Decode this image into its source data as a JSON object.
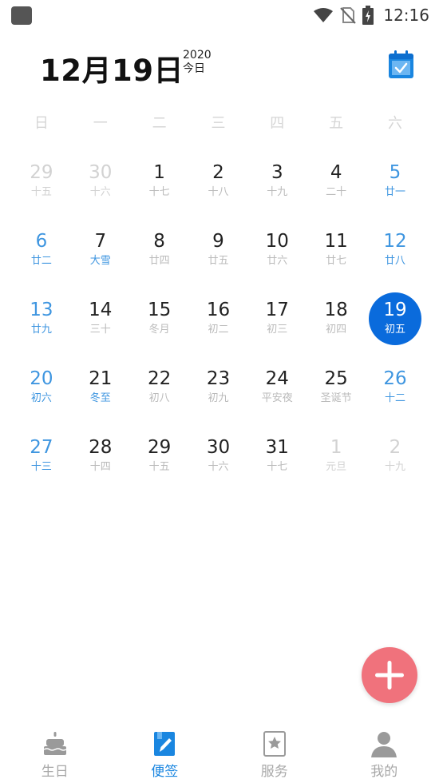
{
  "status_bar": {
    "time": "12:16"
  },
  "header": {
    "date": "12月19日",
    "year": "2020",
    "today": "今日"
  },
  "weekdays": [
    "日",
    "一",
    "二",
    "三",
    "四",
    "五",
    "六"
  ],
  "calendar": {
    "rows": [
      [
        {
          "day": "29",
          "lunar": "十五",
          "type": "other"
        },
        {
          "day": "30",
          "lunar": "十六",
          "type": "other"
        },
        {
          "day": "1",
          "lunar": "十七",
          "type": "normal"
        },
        {
          "day": "2",
          "lunar": "十八",
          "type": "normal"
        },
        {
          "day": "3",
          "lunar": "十九",
          "type": "normal"
        },
        {
          "day": "4",
          "lunar": "二十",
          "type": "normal"
        },
        {
          "day": "5",
          "lunar": "廿一",
          "type": "weekend"
        }
      ],
      [
        {
          "day": "6",
          "lunar": "廿二",
          "type": "weekend"
        },
        {
          "day": "7",
          "lunar": "大雪",
          "type": "holiday"
        },
        {
          "day": "8",
          "lunar": "廿四",
          "type": "normal"
        },
        {
          "day": "9",
          "lunar": "廿五",
          "type": "normal"
        },
        {
          "day": "10",
          "lunar": "廿六",
          "type": "normal"
        },
        {
          "day": "11",
          "lunar": "廿七",
          "type": "normal"
        },
        {
          "day": "12",
          "lunar": "廿八",
          "type": "weekend"
        }
      ],
      [
        {
          "day": "13",
          "lunar": "廿九",
          "type": "weekend"
        },
        {
          "day": "14",
          "lunar": "三十",
          "type": "normal"
        },
        {
          "day": "15",
          "lunar": "冬月",
          "type": "normal"
        },
        {
          "day": "16",
          "lunar": "初二",
          "type": "normal"
        },
        {
          "day": "17",
          "lunar": "初三",
          "type": "normal"
        },
        {
          "day": "18",
          "lunar": "初四",
          "type": "normal"
        },
        {
          "day": "19",
          "lunar": "初五",
          "type": "selected"
        }
      ],
      [
        {
          "day": "20",
          "lunar": "初六",
          "type": "weekend"
        },
        {
          "day": "21",
          "lunar": "冬至",
          "type": "holiday"
        },
        {
          "day": "22",
          "lunar": "初八",
          "type": "normal"
        },
        {
          "day": "23",
          "lunar": "初九",
          "type": "normal"
        },
        {
          "day": "24",
          "lunar": "平安夜",
          "type": "normal"
        },
        {
          "day": "25",
          "lunar": "圣诞节",
          "type": "normal"
        },
        {
          "day": "26",
          "lunar": "十二",
          "type": "weekend"
        }
      ],
      [
        {
          "day": "27",
          "lunar": "十三",
          "type": "weekend"
        },
        {
          "day": "28",
          "lunar": "十四",
          "type": "normal"
        },
        {
          "day": "29",
          "lunar": "十五",
          "type": "normal"
        },
        {
          "day": "30",
          "lunar": "十六",
          "type": "normal"
        },
        {
          "day": "31",
          "lunar": "十七",
          "type": "normal"
        },
        {
          "day": "1",
          "lunar": "元旦",
          "type": "other"
        },
        {
          "day": "2",
          "lunar": "十九",
          "type": "other"
        }
      ]
    ]
  },
  "nav": [
    {
      "label": "生日",
      "icon": "birthday-cake-icon",
      "active": false
    },
    {
      "label": "便签",
      "icon": "note-pen-icon",
      "active": true
    },
    {
      "label": "服务",
      "icon": "star-card-icon",
      "active": false
    },
    {
      "label": "我的",
      "icon": "user-icon",
      "active": false
    }
  ],
  "colors": {
    "accent": "#0a6bdc",
    "weekend": "#3f96e0",
    "fab": "#f0727c",
    "nav_active": "#1a86e0"
  }
}
